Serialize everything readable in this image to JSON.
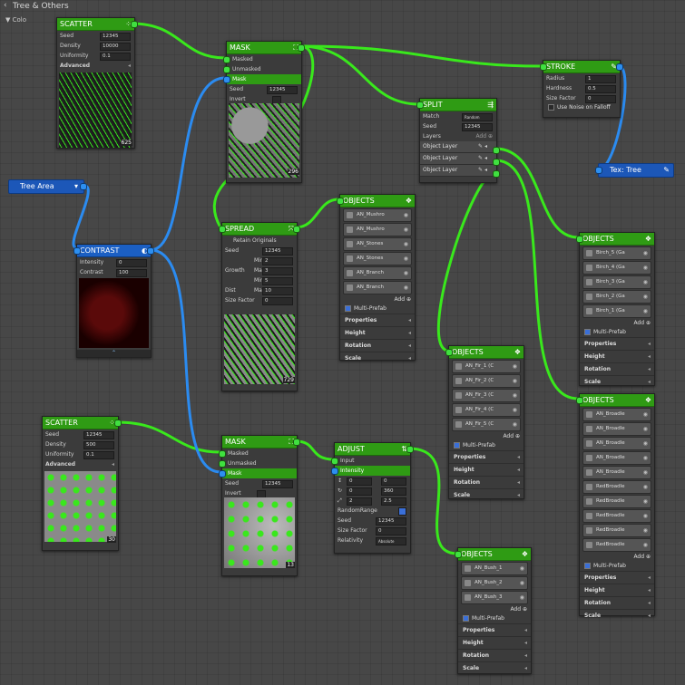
{
  "window": {
    "title": "Tree & Others",
    "group_label": "Colo"
  },
  "colors": {
    "node_header": "#2f9b14",
    "contrast_header": "#1b5fc3",
    "wire_green": "#39e81c",
    "wire_blue": "#2b8bf0"
  },
  "scatter1": {
    "title": "SCATTER",
    "rows": [
      [
        "Seed",
        "12345"
      ],
      [
        "Density",
        "10000"
      ],
      [
        "Uniformity",
        "0.1"
      ]
    ],
    "advanced": "Advanced",
    "count": "625"
  },
  "mask1": {
    "title": "MASK",
    "inputs": [
      "Masked",
      "Unmasked",
      "Mask"
    ],
    "seed_label": "Seed",
    "seed": "12345",
    "invert": "Invert",
    "count": "296"
  },
  "stroke": {
    "title": "STROKE",
    "rows": [
      [
        "Radius",
        "1"
      ],
      [
        "Hardness",
        "0.5"
      ],
      [
        "Size Factor",
        "0"
      ]
    ],
    "falloff": "Use Noise on Falloff"
  },
  "split": {
    "title": "SPLIT",
    "match_label": "Match",
    "match_value": "Random",
    "seed_label": "Seed",
    "seed": "12345",
    "layers_label": "Layers",
    "add": "Add",
    "layers": [
      "Object Layer",
      "Object Layer",
      "Object Layer"
    ]
  },
  "tex_tree": {
    "label": "Tex: Tree"
  },
  "tree_area": {
    "label": "Tree Area"
  },
  "contrast": {
    "title": "CONTRAST",
    "rows": [
      [
        "Intensity",
        "0"
      ],
      [
        "Contrast",
        "100"
      ]
    ]
  },
  "spread": {
    "title": "SPREAD",
    "retain": "Retain Originals",
    "seed_label": "Seed",
    "seed": "12345",
    "growth": "Growth",
    "dist": "Dist",
    "min": "Min",
    "max": "Ma",
    "growth_min": "2",
    "growth_max": "3",
    "dist_min": "5",
    "dist_max": "10",
    "size_factor_label": "Size Factor",
    "size_factor": "0",
    "count": "729"
  },
  "objects1": {
    "title": "OBJECTS",
    "items": [
      "AN_Mushro",
      "AN_Mushro",
      "AN_Stones",
      "AN_Stones",
      "AN_Branch",
      "AN_Branch"
    ],
    "add": "Add",
    "multi": "Multi-Prefab",
    "sections": [
      "Properties",
      "Height",
      "Rotation",
      "Scale"
    ]
  },
  "objects_birch": {
    "title": "OBJECTS",
    "items": [
      "Birch_5 (Ga",
      "Birch_4 (Ga",
      "Birch_3 (Ga",
      "Birch_2 (Ga",
      "Birch_1 (Ga"
    ],
    "add": "Add",
    "multi": "Multi-Prefab",
    "sections": [
      "Properties",
      "Height",
      "Rotation",
      "Scale"
    ]
  },
  "objects_fir": {
    "title": "OBJECTS",
    "items": [
      "AN_Fir_1 (C",
      "AN_Fir_2 (C",
      "AN_Fir_3 (C",
      "AN_Fir_4 (C",
      "AN_Fir_5 (C"
    ],
    "add": "Add",
    "multi": "Multi-Prefab",
    "sections": [
      "Properties",
      "Height",
      "Rotation",
      "Scale"
    ]
  },
  "objects_broad": {
    "title": "OBJECTS",
    "items": [
      "AN_Broadle",
      "AN_Broadle",
      "AN_Broadle",
      "AN_Broadle",
      "AN_Broadle",
      "RedBroadle",
      "RedBroadle",
      "RedBroadle",
      "RedBroadle",
      "RedBroadle"
    ],
    "add": "Add",
    "multi": "Multi-Prefab",
    "sections": [
      "Properties",
      "Height",
      "Rotation",
      "Scale"
    ]
  },
  "scatter2": {
    "title": "SCATTER",
    "rows": [
      [
        "Seed",
        "12345"
      ],
      [
        "Density",
        "500"
      ],
      [
        "Uniformity",
        "0.1"
      ]
    ],
    "advanced": "Advanced",
    "count": "30"
  },
  "mask2": {
    "title": "MASK",
    "inputs": [
      "Masked",
      "Unmasked",
      "Mask"
    ],
    "seed_label": "Seed",
    "seed": "12345",
    "invert": "Invert",
    "count": "13"
  },
  "adjust": {
    "title": "ADJUST",
    "inputs": [
      "Input",
      "Intensity"
    ],
    "r1": [
      "0",
      "0"
    ],
    "r2": [
      "0",
      "360"
    ],
    "r3": [
      "2",
      "2.5"
    ],
    "random_range": "RandomRange",
    "seed_label": "Seed",
    "seed": "12345",
    "size_factor_label": "Size Factor",
    "size_factor": "0",
    "relativity": "Relativity",
    "relativity_value": "Absolute"
  },
  "objects_bush": {
    "title": "OBJECTS",
    "items": [
      "AN_Bush_1",
      "AN_Bush_2",
      "AN_Bush_3"
    ],
    "add": "Add",
    "multi": "Multi-Prefab",
    "sections": [
      "Properties",
      "Height",
      "Rotation",
      "Scale"
    ]
  }
}
